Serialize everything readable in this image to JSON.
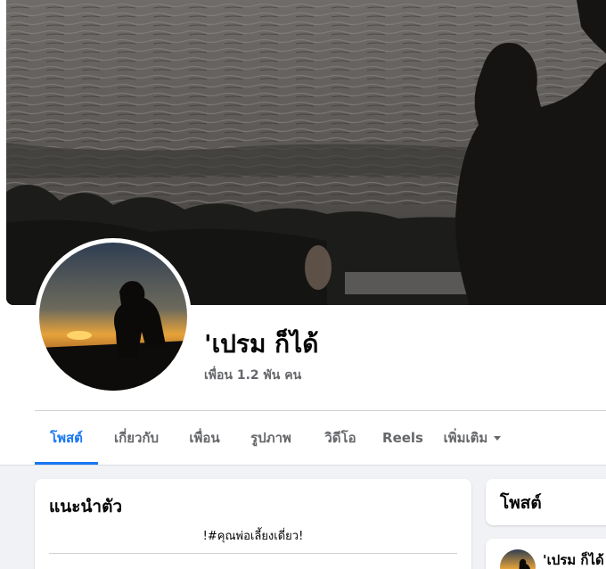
{
  "profile": {
    "name": "'เปรม ก็ได้",
    "friends": "เพื่อน 1.2 พัน คน"
  },
  "tabs": [
    {
      "label": "โพสต์",
      "active": true
    },
    {
      "label": "เกี่ยวกับ",
      "active": false
    },
    {
      "label": "เพื่อน",
      "active": false
    },
    {
      "label": "รูปภาพ",
      "active": false
    },
    {
      "label": "วิดีโอ",
      "active": false
    },
    {
      "label": "Reels",
      "active": false
    },
    {
      "label": "เพิ่มเติม",
      "active": false
    }
  ],
  "intro": {
    "title": "แนะนำตัว",
    "bio": "!#คุณพ่อเลี้ยงเดี่ยว!"
  },
  "posts": {
    "title": "โพสต์",
    "author": "'เปรม ก็ได้"
  },
  "colors": {
    "accent": "#1877f2",
    "background": "#f0f2f5",
    "text_secondary": "#65676b"
  }
}
